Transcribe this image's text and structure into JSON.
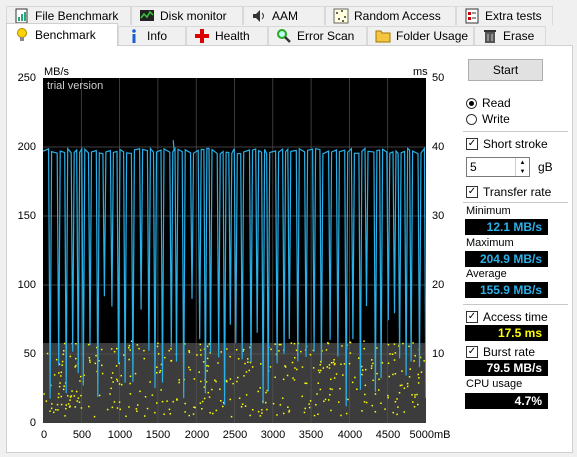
{
  "tabs_row1": [
    {
      "label": "File Benchmark",
      "icon": "file-benchmark-icon"
    },
    {
      "label": "Disk monitor",
      "icon": "disk-monitor-icon"
    },
    {
      "label": "AAM",
      "icon": "speaker-icon"
    },
    {
      "label": "Random Access",
      "icon": "random-access-icon"
    },
    {
      "label": "Extra tests",
      "icon": "extra-tests-icon"
    }
  ],
  "tabs_row2": [
    {
      "label": "Benchmark",
      "icon": "lightbulb-icon"
    },
    {
      "label": "Info",
      "icon": "info-icon"
    },
    {
      "label": "Health",
      "icon": "health-cross-icon"
    },
    {
      "label": "Error Scan",
      "icon": "magnifier-icon"
    },
    {
      "label": "Folder Usage",
      "icon": "folder-icon"
    },
    {
      "label": "Erase",
      "icon": "trash-icon"
    }
  ],
  "chart": {
    "left_unit": "MB/s",
    "right_unit": "ms",
    "watermark": "trial version",
    "x_unit": "mB"
  },
  "chart_data": {
    "type": "line",
    "left_axis": {
      "label": "MB/s",
      "min": 0,
      "max": 250,
      "ticks": [
        "250",
        "200",
        "150",
        "100",
        "50",
        "0"
      ]
    },
    "right_axis": {
      "label": "ms",
      "min": 0,
      "max": 50,
      "ticks": [
        "50",
        "40",
        "30",
        "20",
        "10"
      ]
    },
    "x_axis": {
      "label": "mB",
      "min": 0,
      "max": 5000,
      "ticks": [
        "0",
        "500",
        "1000",
        "1500",
        "2000",
        "2500",
        "3000",
        "3500",
        "4000",
        "4500",
        "5000mB"
      ]
    },
    "series": [
      {
        "name": "Transfer rate",
        "color": "#2ab0e8",
        "style": "line",
        "baseline": 197,
        "peak": 204.9,
        "min": 12.1,
        "avg": 155.9
      },
      {
        "name": "Access time",
        "color": "#ffff00",
        "style": "scatter",
        "typical_ms": 17.5
      }
    ],
    "grid": true
  },
  "controls": {
    "start_label": "Start",
    "read_label": "Read",
    "write_label": "Write",
    "short_stroke_label": "Short stroke",
    "stroke_value": "5",
    "stroke_unit": "gB",
    "transfer_rate_label": "Transfer rate",
    "access_time_label": "Access time",
    "burst_rate_label": "Burst rate"
  },
  "stats": {
    "minimum_label": "Minimum",
    "minimum_value": "12.1 MB/s",
    "maximum_label": "Maximum",
    "maximum_value": "204.9 MB/s",
    "average_label": "Average",
    "average_value": "155.9 MB/s",
    "access_time_value": "17.5 ms",
    "burst_rate_value": "79.5 MB/s",
    "cpu_label": "CPU usage",
    "cpu_value": "4.7%"
  },
  "colors": {
    "chart_bg": "#000000",
    "transfer_line": "#2ab0e8",
    "access_dots": "#ffff00",
    "stat_blue": "#2ab0e8",
    "stat_yellow": "#ffff00",
    "stat_white": "#ffffff"
  }
}
